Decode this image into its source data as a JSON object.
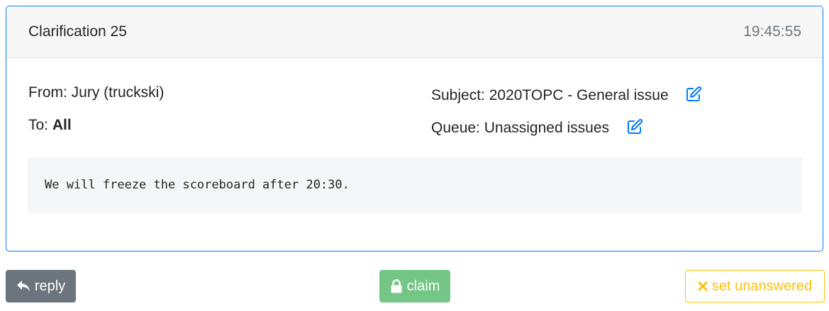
{
  "header": {
    "title": "Clarification 25",
    "time": "19:45:55"
  },
  "fields": {
    "from_label": "From: ",
    "from_value": "Jury (truckski)",
    "to_label": "To: ",
    "to_value": "All",
    "subject_label": "Subject: ",
    "subject_value": "2020TOPC - General issue",
    "queue_label": "Queue: ",
    "queue_value": "Unassigned issues"
  },
  "message": {
    "text": "We will freeze the scoreboard after 20:30."
  },
  "actions": {
    "reply_label": "reply",
    "claim_label": "claim",
    "unanswered_label": "set unanswered"
  },
  "colors": {
    "accent": "#007bff",
    "reply_bg": "#6c757d",
    "claim_bg": "#74c687",
    "unanswered": "#ffc107"
  },
  "icons": {
    "edit_subject": "edit-icon",
    "edit_queue": "edit-icon",
    "reply": "reply-icon",
    "claim": "lock-icon",
    "unanswered": "x-icon"
  }
}
